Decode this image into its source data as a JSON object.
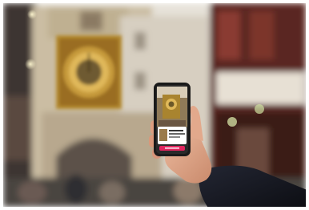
{
  "scene": {
    "palette": {
      "sky": "#d9d4cb",
      "stone": "#c8b79a",
      "clock_gold": "#b88a2e",
      "clock_face": "#d4a84a",
      "facade_right": "#6b2a24",
      "timber": "#3a2420",
      "phone_frame": "#1a1a1a",
      "phone_accent": "#e0245e",
      "skin": "#e2a98c",
      "sleeve": "#14161d",
      "border": "#ffffff"
    },
    "objects": [
      "gros-horloge-clock",
      "stone-arch-gate",
      "half-timbered-facade",
      "crowd",
      "hand",
      "smartphone"
    ]
  },
  "phone": {
    "app_card_lines": [
      "",
      "",
      ""
    ],
    "cta_label": ""
  }
}
